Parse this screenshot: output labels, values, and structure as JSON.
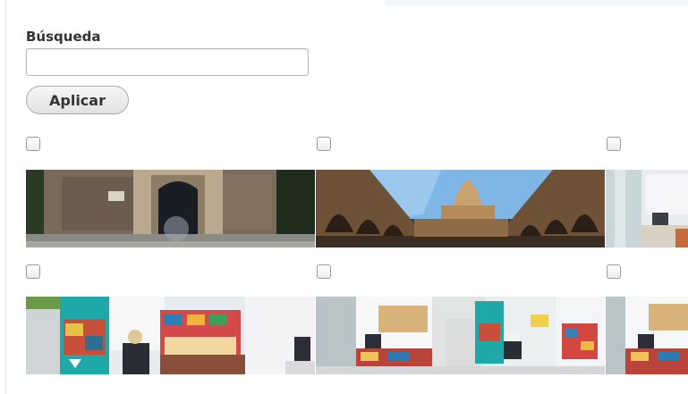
{
  "search": {
    "label": "Búsqueda",
    "value": "",
    "placeholder": ""
  },
  "apply_button": {
    "label": "Aplicar"
  },
  "gallery": {
    "rows": [
      {
        "items": [
          {
            "icon": "photo-stone-gate",
            "checked": false
          },
          {
            "icon": "photo-arcaded-cloister",
            "checked": false
          },
          {
            "icon": "photo-office-partial",
            "checked": false
          }
        ]
      },
      {
        "items": [
          {
            "icon": "photo-tourist-office-brochures",
            "checked": false
          },
          {
            "icon": "photo-tourist-office-desks",
            "checked": false
          },
          {
            "icon": "photo-tourist-office-partial",
            "checked": false
          }
        ]
      }
    ]
  },
  "colors": {
    "button_border": "#a9a9a9",
    "label_text": "#333333",
    "accent_teal": "#1ea9a8"
  }
}
